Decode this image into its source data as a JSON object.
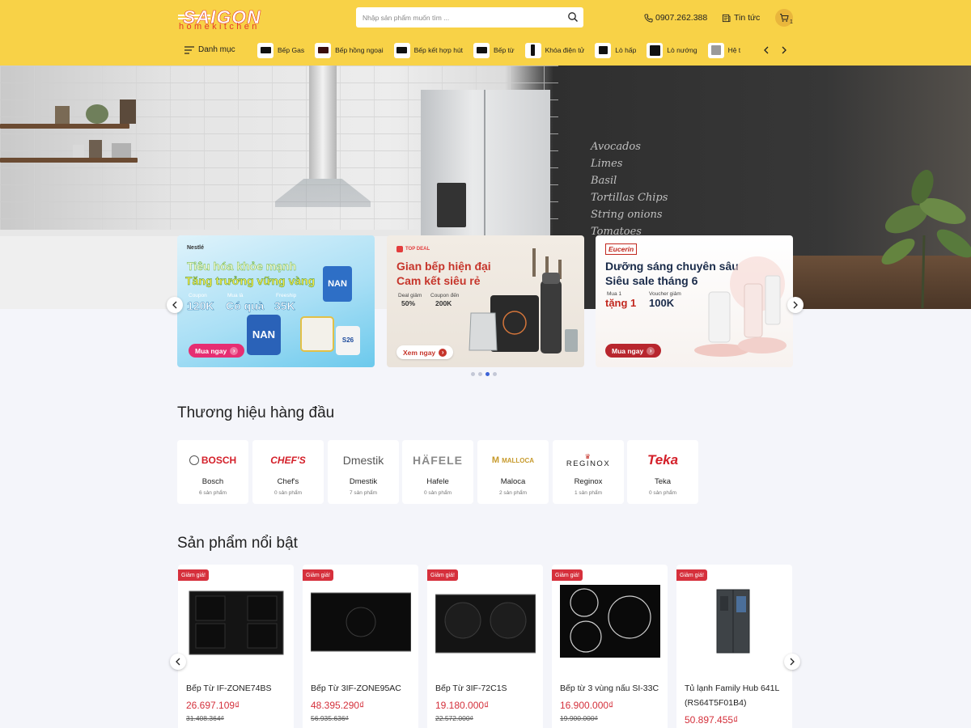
{
  "header": {
    "logo_main": "SAIGON",
    "logo_sub": "homekitchen",
    "search_placeholder": "Nhập sản phẩm muốn tìm ...",
    "hotline": "0907.262.388",
    "news_label": "Tin tức",
    "cart_count": "1",
    "accent_color": "#f8d247"
  },
  "nav": {
    "menu_label": "Danh mục",
    "categories": [
      {
        "label": "Bếp Gas",
        "icon": "gas-stove-icon"
      },
      {
        "label": "Bếp hồng ngoại",
        "icon": "infrared-stove-icon"
      },
      {
        "label": "Bếp kết hợp hút",
        "icon": "combo-stove-icon"
      },
      {
        "label": "Bếp từ",
        "icon": "induction-stove-icon"
      },
      {
        "label": "Khóa điện tử",
        "icon": "smart-lock-icon"
      },
      {
        "label": "Lò hấp",
        "icon": "steam-oven-icon"
      },
      {
        "label": "Lò nướng",
        "icon": "oven-icon"
      },
      {
        "label": "Hệ t",
        "icon": "system-icon"
      }
    ]
  },
  "hero": {
    "promo1": {
      "brand": "Nestlé",
      "title1": "Tiêu hóa khỏe mạnh",
      "title2": "Tăng trưởng vững vàng",
      "offer1_label": "Coupon",
      "offer1_value": "120K",
      "offer2_label": "Mua là",
      "offer2_value": "Có quà",
      "offer3_label": "Freeship",
      "offer3_value": "35K",
      "product_a": "NAN",
      "product_b": "NAN",
      "product_c": "S26",
      "cta": "Mua ngay"
    },
    "promo2": {
      "tag": "TOP DEAL",
      "title1": "Gian bếp hiện đại",
      "title2": "Cam kết siêu rẻ",
      "offer1_label": "Deal giảm",
      "offer1_value": "50%",
      "offer2_label": "Coupon đến",
      "offer2_value": "200K",
      "cta": "Xem ngay"
    },
    "promo3": {
      "brand": "Eucerin",
      "title1": "Dưỡng sáng chuyên sâu",
      "title2": "Siêu sale tháng 6",
      "offer1_label": "Mua 1",
      "offer1_value": "tặng 1",
      "offer2_label": "Voucher giảm",
      "offer2_value": "100K",
      "cta": "Mua ngay"
    },
    "chalkboard": [
      "Avocados",
      "Limes",
      "Basil",
      "Tortillas Chips",
      "String onions",
      "Tomatoes"
    ],
    "active_dot": 3,
    "dot_count": 4
  },
  "brands": {
    "title": "Thương hiệu hàng đầu",
    "items": [
      {
        "logo": "BOSCH",
        "name": "Bosch",
        "count": "6 sản phẩm"
      },
      {
        "logo": "CHEF'S",
        "name": "Chef's",
        "count": "0 sản phẩm"
      },
      {
        "logo": "Dmestik",
        "name": "Dmestik",
        "count": "7 sản phẩm"
      },
      {
        "logo": "HÄFELE",
        "name": "Hafele",
        "count": "0 sản phẩm"
      },
      {
        "logo": "MALLOCA",
        "name": "Maloca",
        "count": "2 sản phẩm"
      },
      {
        "logo": "REGINOX",
        "name": "Reginox",
        "count": "1 sản phẩm"
      },
      {
        "logo": "Teka",
        "name": "Teka",
        "count": "0 sản phẩm"
      }
    ]
  },
  "products": {
    "title": "Sản phẩm nổi bật",
    "badge": "Giảm giá!",
    "items": [
      {
        "name": "Bếp Từ IF-ZONE74BS",
        "price": "26.697.109₫",
        "old_price": "31.408.364₫"
      },
      {
        "name": "Bếp Từ 3IF-ZONE95AC",
        "price": "48.395.290₫",
        "old_price": "56.935.636₫"
      },
      {
        "name": "Bếp Từ 3IF-72C1S",
        "price": "19.180.000₫",
        "old_price": "22.572.000₫"
      },
      {
        "name": "Bếp từ 3 vùng nấu SI-33C",
        "price": "16.900.000₫",
        "old_price": "19.900.000₫"
      },
      {
        "name": "Tủ lạnh Family Hub 641L (RS64T5F01B4)",
        "price": "50.897.455₫",
        "old_price": ""
      }
    ]
  }
}
